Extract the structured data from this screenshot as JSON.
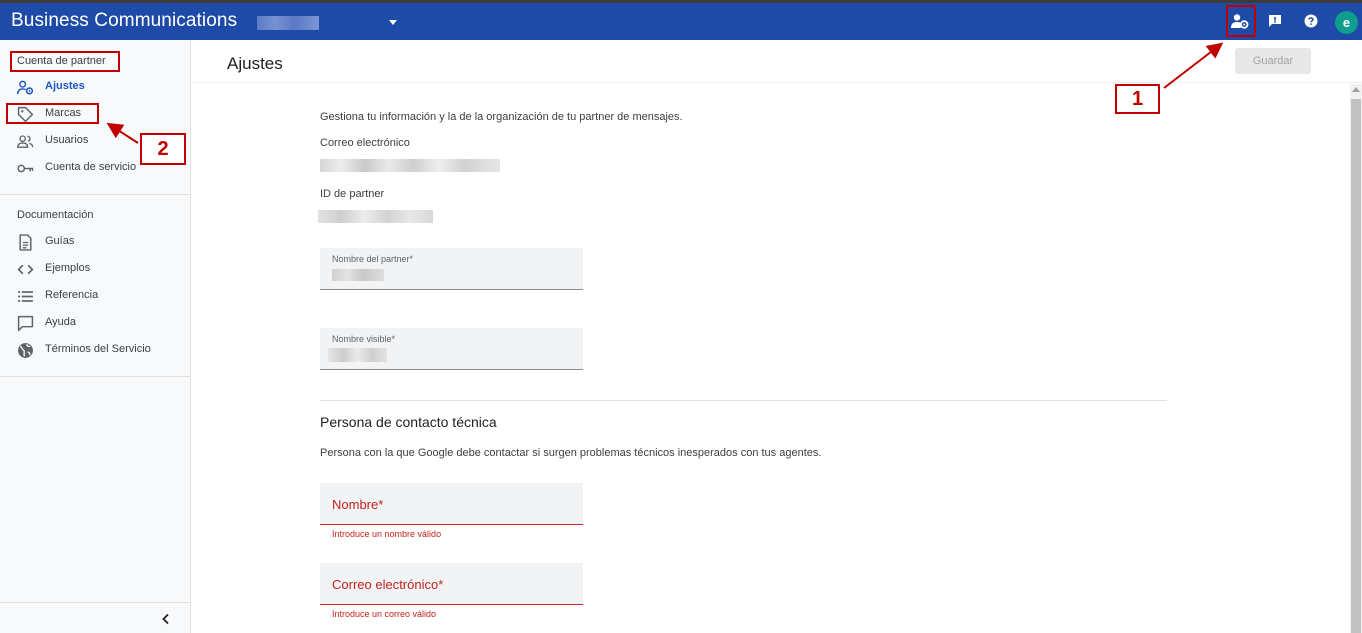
{
  "app": {
    "title": "Business Communications"
  },
  "topbar": {
    "icons": [
      "partner-settings-icon",
      "feedback-icon",
      "help-icon"
    ],
    "avatar_letter": "e"
  },
  "sidebar": {
    "partner_section_title": "Cuenta de partner",
    "partner_items": [
      {
        "label": "Ajustes",
        "icon": "partner-settings-icon",
        "active": true
      },
      {
        "label": "Marcas",
        "icon": "tag-icon",
        "active": false
      },
      {
        "label": "Usuarios",
        "icon": "users-icon",
        "active": false
      },
      {
        "label": "Cuenta de servicio",
        "icon": "key-icon",
        "active": false
      }
    ],
    "docs_section_title": "Documentación",
    "docs_items": [
      {
        "label": "Guías",
        "icon": "document-icon"
      },
      {
        "label": "Ejemplos",
        "icon": "code-icon"
      },
      {
        "label": "Referencia",
        "icon": "list-icon"
      },
      {
        "label": "Ayuda",
        "icon": "chat-bubble-icon"
      },
      {
        "label": "Términos del Servicio",
        "icon": "globe-icon"
      }
    ]
  },
  "main": {
    "page_title": "Ajustes",
    "save_label": "Guardar",
    "intro": "Gestiona tu información y la de la organización de tu partner de mensajes.",
    "email_label": "Correo electrónico",
    "partner_id_label": "ID de partner",
    "partner_name_label": "Nombre del partner*",
    "display_name_label": "Nombre visible*",
    "tech_contact_heading": "Persona de contacto técnica",
    "tech_contact_desc": "Persona con la que Google debe contactar si surgen problemas técnicos inesperados con tus agentes.",
    "name_field_label": "Nombre*",
    "name_error": "Introduce un nombre válido",
    "email_field_label": "Correo electrónico*",
    "email_error": "Introduce un correo válido"
  },
  "annotations": {
    "callout_1": "1",
    "callout_2": "2"
  },
  "colors": {
    "topbar": "#1e4aa8",
    "accent": "#1a56c4",
    "error": "#c5221f",
    "annotation": "#c00000"
  }
}
